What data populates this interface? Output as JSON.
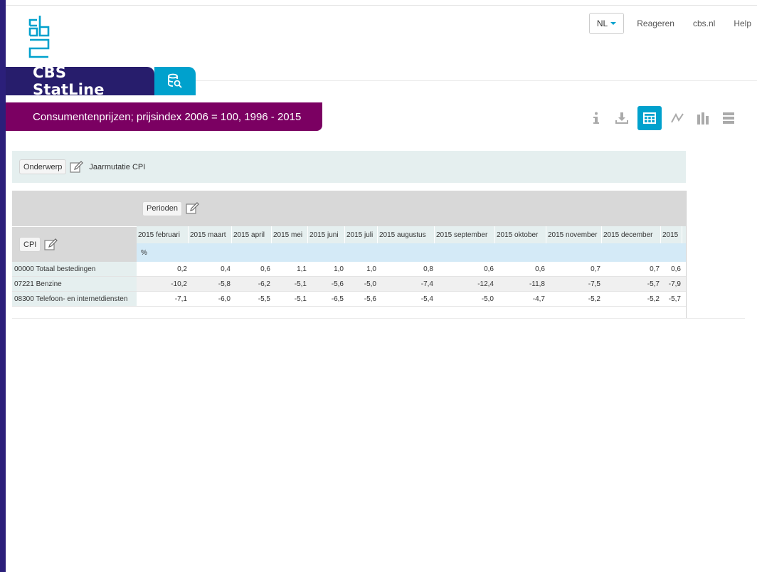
{
  "topnav": {
    "language": "NL",
    "links": [
      "Reageren",
      "cbs.nl",
      "Help"
    ]
  },
  "brand": {
    "title": "CBS StatLine"
  },
  "table_title": "Consumentenprijzen; prijsindex 2006 = 100, 1996 - 2015",
  "view_icons": [
    "info-icon",
    "download-icon",
    "table-icon",
    "line-chart-icon",
    "bar-chart-icon",
    "horizontal-bar-icon"
  ],
  "filter": {
    "chip": "Onderwerp",
    "value": "Jaarmutatie CPI"
  },
  "table": {
    "periods_chip": "Perioden",
    "row_header_chip": "CPI",
    "unit": "%",
    "columns": [
      "2015 februari",
      "2015 maart",
      "2015 april",
      "2015 mei",
      "2015 juni",
      "2015 juli",
      "2015 augustus",
      "2015 september",
      "2015 oktober",
      "2015 november",
      "2015 december",
      "2015"
    ],
    "rows": [
      {
        "label": "00000 Totaal bestedingen",
        "values": [
          "0,2",
          "0,4",
          "0,6",
          "1,1",
          "1,0",
          "1,0",
          "0,8",
          "0,6",
          "0,6",
          "0,7",
          "0,7",
          "0,6"
        ]
      },
      {
        "label": "07221 Benzine",
        "values": [
          "-10,2",
          "-5,8",
          "-6,2",
          "-5,1",
          "-5,6",
          "-5,0",
          "-7,4",
          "-12,4",
          "-11,8",
          "-7,5",
          "-5,7",
          "-7,9"
        ]
      },
      {
        "label": "08300 Telefoon- en internetdiensten",
        "values": [
          "-7,1",
          "-6,0",
          "-5,5",
          "-5,1",
          "-6,5",
          "-5,6",
          "-5,4",
          "-5,0",
          "-4,7",
          "-5,2",
          "-5,2",
          "-5,7"
        ]
      }
    ]
  },
  "colors": {
    "brand_navy": "#271d6c",
    "accent_blue": "#00a1cd",
    "title_purple": "#7b0062"
  }
}
